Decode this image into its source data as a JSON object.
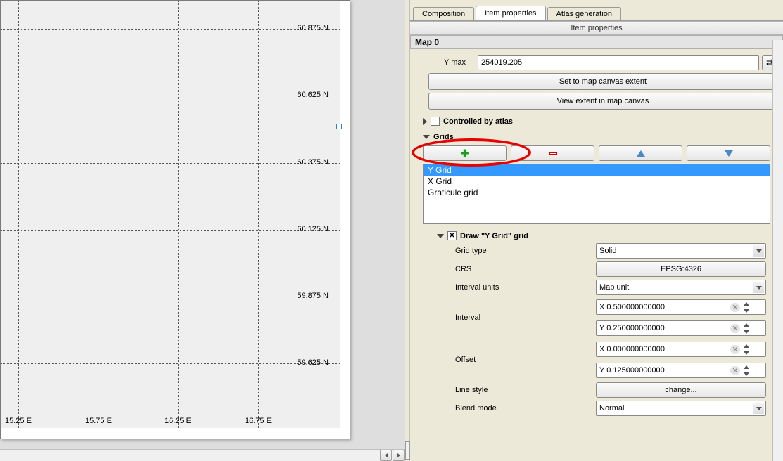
{
  "tabs": {
    "composition": "Composition",
    "item_properties": "Item properties",
    "atlas": "Atlas generation"
  },
  "panel_title": "Item properties",
  "section": "Map 0",
  "ymax_label": "Y max",
  "ymax_value": "254019.205",
  "btn_set_extent": "Set to map canvas extent",
  "btn_view_extent": "View extent in map canvas",
  "atlas_label": "Controlled by atlas",
  "grids_label": "Grids",
  "grid_items": [
    "Y Grid",
    "X Grid",
    "Graticule grid"
  ],
  "draw_grid_label": "Draw \"Y Grid\" grid",
  "props": {
    "grid_type": {
      "label": "Grid type",
      "value": "Solid"
    },
    "crs": {
      "label": "CRS",
      "value": "EPSG:4326"
    },
    "interval_units": {
      "label": "Interval units",
      "value": "Map unit"
    },
    "interval": {
      "label": "Interval",
      "x": "X 0.500000000000",
      "y": "Y 0.250000000000"
    },
    "offset": {
      "label": "Offset",
      "x": "X 0.000000000000",
      "y": "Y 0.125000000000"
    },
    "line_style": {
      "label": "Line style",
      "value": "change..."
    },
    "blend_mode": {
      "label": "Blend mode",
      "value": "Normal"
    }
  },
  "map": {
    "lat_labels": [
      "60.875 N",
      "60.625 N",
      "60.375 N",
      "60.125 N",
      "59.875 N",
      "59.625 N"
    ],
    "lon_labels": [
      "15.25 E",
      "15.75 E",
      "16.25 E",
      "16.75 E"
    ]
  }
}
